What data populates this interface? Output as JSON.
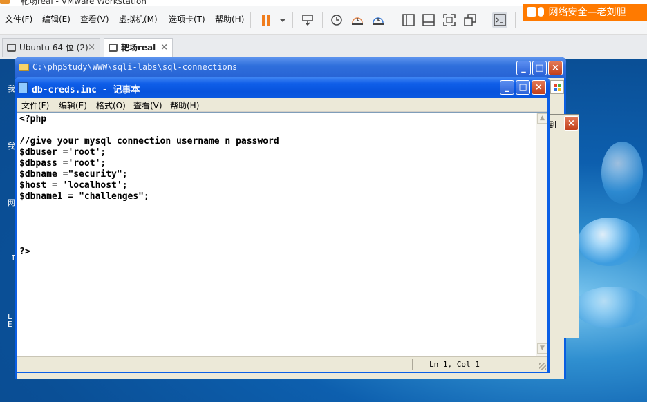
{
  "host": {
    "title": "靶场real - VMware Workstation",
    "menu": [
      "文件(F)",
      "编辑(E)",
      "查看(V)",
      "虚拟机(M)",
      "选项卡(T)",
      "帮助(H)"
    ],
    "notification": "网络安全—老刘胆",
    "tabs": [
      {
        "label": "Ubuntu 64 位 (2)",
        "close": "×"
      },
      {
        "label": "靶场real",
        "close": "×"
      }
    ]
  },
  "explorer": {
    "path": "C:\\phpStudy\\WWW\\sqli-labs\\sql-connections",
    "right_label": "到"
  },
  "notepad": {
    "title": "db-creds.inc - 记事本",
    "menu": [
      "文件(F)",
      "编辑(E)",
      "格式(O)",
      "查看(V)",
      "帮助(H)"
    ],
    "lines": [
      "<?php",
      "",
      "//give your mysql connection username n password",
      "$dbuser ='root';",
      "$dbpass ='root';",
      "$dbname =\"security\";",
      "$host = 'localhost';",
      "$dbname1 = \"challenges\";",
      "",
      "",
      "",
      "",
      "?>"
    ],
    "status": "Ln 1, Col 1"
  },
  "desktop_glyphs": [
    "我",
    "我",
    "网",
    "I",
    "L",
    "E"
  ],
  "colors": {
    "xp_title": "#0a58e0",
    "accent_orange": "#ff7a00",
    "pause": "#f07d1e"
  }
}
